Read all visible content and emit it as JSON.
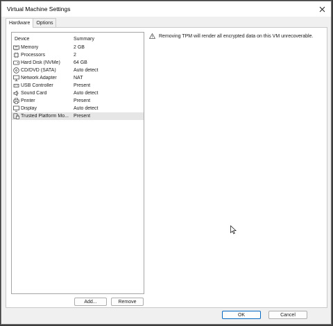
{
  "window": {
    "title": "Virtual Machine Settings"
  },
  "tabs": [
    {
      "label": "Hardware",
      "active": true
    },
    {
      "label": "Options",
      "active": false
    }
  ],
  "device_list": {
    "headers": {
      "device": "Device",
      "summary": "Summary"
    },
    "rows": [
      {
        "icon": "memory-icon",
        "device": "Memory",
        "summary": "2 GB"
      },
      {
        "icon": "processor-icon",
        "device": "Processors",
        "summary": "2"
      },
      {
        "icon": "hard-disk-icon",
        "device": "Hard Disk (NVMe)",
        "summary": "64 GB"
      },
      {
        "icon": "cd-dvd-icon",
        "device": "CD/DVD (SATA)",
        "summary": "Auto detect"
      },
      {
        "icon": "network-icon",
        "device": "Network Adapter",
        "summary": "NAT"
      },
      {
        "icon": "usb-icon",
        "device": "USB Controller",
        "summary": "Present"
      },
      {
        "icon": "sound-icon",
        "device": "Sound Card",
        "summary": "Auto detect"
      },
      {
        "icon": "printer-icon",
        "device": "Printer",
        "summary": "Present"
      },
      {
        "icon": "display-icon",
        "device": "Display",
        "summary": "Auto detect"
      },
      {
        "icon": "tpm-icon",
        "device": "Trusted Platform Mo...",
        "summary": "Present",
        "selected": true
      }
    ]
  },
  "list_buttons": {
    "add": "Add...",
    "remove": "Remove"
  },
  "warning": {
    "icon": "warning-icon",
    "text": "Removing TPM will render all encrypted data on this VM unrecoverable."
  },
  "footer_buttons": {
    "ok": "OK",
    "cancel": "Cancel"
  }
}
